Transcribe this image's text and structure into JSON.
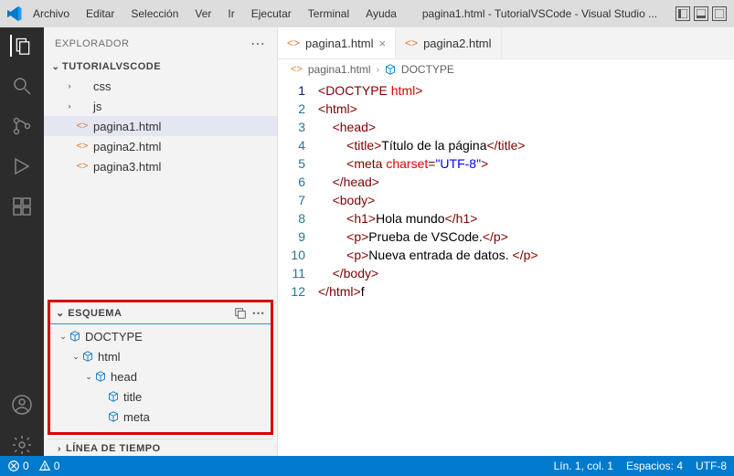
{
  "titlebar": {
    "menus": [
      "Archivo",
      "Editar",
      "Selección",
      "Ver",
      "Ir",
      "Ejecutar",
      "Terminal",
      "Ayuda"
    ],
    "title": "pagina1.html - TutorialVSCode - Visual Studio ..."
  },
  "sidebar": {
    "header": "EXPLORADOR",
    "project": "TUTORIALVSCODE",
    "items": [
      {
        "type": "folder",
        "label": "css",
        "indent": 1
      },
      {
        "type": "folder",
        "label": "js",
        "indent": 1
      },
      {
        "type": "file",
        "label": "pagina1.html",
        "indent": 1,
        "selected": true
      },
      {
        "type": "file",
        "label": "pagina2.html",
        "indent": 1
      },
      {
        "type": "file",
        "label": "pagina3.html",
        "indent": 1
      }
    ],
    "outline": {
      "title": "ESQUEMA",
      "nodes": [
        {
          "label": "DOCTYPE",
          "indent": 0,
          "expanded": true
        },
        {
          "label": "html",
          "indent": 1,
          "expanded": true
        },
        {
          "label": "head",
          "indent": 2,
          "expanded": true
        },
        {
          "label": "title",
          "indent": 3,
          "expanded": false,
          "leaf": true
        },
        {
          "label": "meta",
          "indent": 3,
          "expanded": false,
          "leaf": true
        }
      ]
    },
    "timeline": "LÍNEA DE TIEMPO"
  },
  "editor": {
    "tabs": [
      {
        "label": "pagina1.html",
        "active": true,
        "closeable": true
      },
      {
        "label": "pagina2.html",
        "active": false,
        "closeable": false
      }
    ],
    "breadcrumb": [
      "pagina1.html",
      "DOCTYPE"
    ],
    "lines": [
      {
        "n": 1,
        "tokens": [
          [
            "br",
            "<"
          ],
          [
            "tag",
            "DOCTYPE "
          ],
          [
            "attr",
            "html"
          ],
          [
            "br",
            ">"
          ]
        ],
        "indent": 0
      },
      {
        "n": 2,
        "tokens": [
          [
            "br",
            "<"
          ],
          [
            "tag",
            "html"
          ],
          [
            "br",
            ">"
          ]
        ],
        "indent": 0
      },
      {
        "n": 3,
        "tokens": [
          [
            "br",
            "<"
          ],
          [
            "tag",
            "head"
          ],
          [
            "br",
            ">"
          ]
        ],
        "indent": 1
      },
      {
        "n": 4,
        "tokens": [
          [
            "br",
            "<"
          ],
          [
            "tag",
            "title"
          ],
          [
            "br",
            ">"
          ],
          [
            "txt",
            "Título de la página"
          ],
          [
            "br",
            "</"
          ],
          [
            "tag",
            "title"
          ],
          [
            "br",
            ">"
          ]
        ],
        "indent": 2
      },
      {
        "n": 5,
        "tokens": [
          [
            "br",
            "<"
          ],
          [
            "tag",
            "meta "
          ],
          [
            "attr",
            "charset"
          ],
          [
            "tag",
            "="
          ],
          [
            "str",
            "\"UTF-8\""
          ],
          [
            "br",
            ">"
          ]
        ],
        "indent": 2
      },
      {
        "n": 6,
        "tokens": [
          [
            "br",
            "</"
          ],
          [
            "tag",
            "head"
          ],
          [
            "br",
            ">"
          ]
        ],
        "indent": 1
      },
      {
        "n": 7,
        "tokens": [
          [
            "br",
            "<"
          ],
          [
            "tag",
            "body"
          ],
          [
            "br",
            ">"
          ]
        ],
        "indent": 1
      },
      {
        "n": 8,
        "tokens": [
          [
            "br",
            "<"
          ],
          [
            "tag",
            "h1"
          ],
          [
            "br",
            ">"
          ],
          [
            "txt",
            "Hola mundo"
          ],
          [
            "br",
            "</"
          ],
          [
            "tag",
            "h1"
          ],
          [
            "br",
            ">"
          ]
        ],
        "indent": 2
      },
      {
        "n": 9,
        "tokens": [
          [
            "br",
            "<"
          ],
          [
            "tag",
            "p"
          ],
          [
            "br",
            ">"
          ],
          [
            "txt",
            "Prueba de VSCode."
          ],
          [
            "br",
            "</"
          ],
          [
            "tag",
            "p"
          ],
          [
            "br",
            ">"
          ]
        ],
        "indent": 2
      },
      {
        "n": 10,
        "tokens": [
          [
            "br",
            "<"
          ],
          [
            "tag",
            "p"
          ],
          [
            "br",
            ">"
          ],
          [
            "txt",
            "Nueva entrada de datos. "
          ],
          [
            "br",
            "</"
          ],
          [
            "tag",
            "p"
          ],
          [
            "br",
            ">"
          ]
        ],
        "indent": 2
      },
      {
        "n": 11,
        "tokens": [
          [
            "br",
            "</"
          ],
          [
            "tag",
            "body"
          ],
          [
            "br",
            ">"
          ]
        ],
        "indent": 1
      },
      {
        "n": 12,
        "tokens": [
          [
            "br",
            "</"
          ],
          [
            "tag",
            "html"
          ],
          [
            "br",
            ">"
          ],
          [
            "txt",
            "f"
          ]
        ],
        "indent": 0
      }
    ]
  },
  "statusbar": {
    "errors": "0",
    "warnings": "0",
    "position": "Lín. 1, col. 1",
    "spaces": "Espacios: 4",
    "encoding": "UTF-8"
  }
}
